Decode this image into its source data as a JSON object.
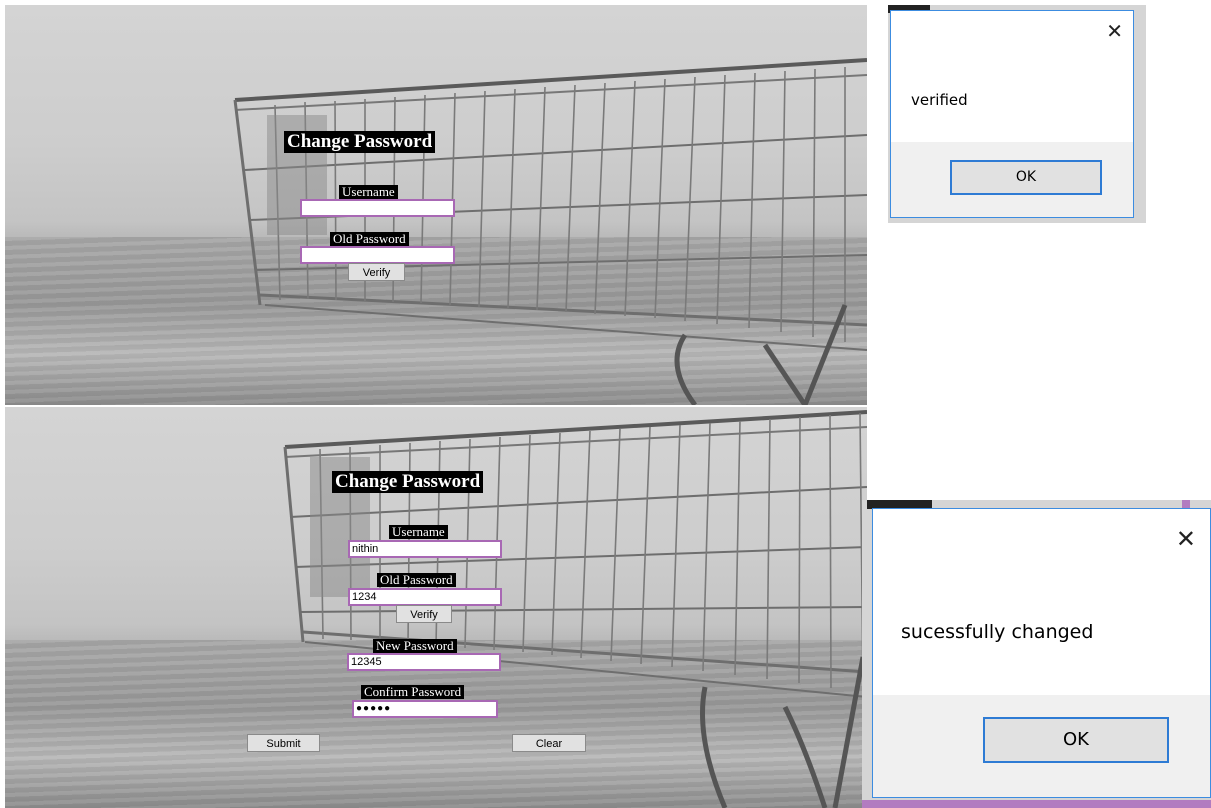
{
  "top_form": {
    "title": "Change Password",
    "username_label": "Username",
    "username_value": "",
    "old_password_label": "Old Password",
    "old_password_value": "",
    "verify_button": "Verify"
  },
  "top_dialog": {
    "message": "verified",
    "ok_button": "OK",
    "close_glyph": "✕"
  },
  "bottom_form": {
    "title": "Change Password",
    "username_label": "Username",
    "username_value": "nithin",
    "old_password_label": "Old Password",
    "old_password_value": "1234",
    "verify_button": "Verify",
    "new_password_label": "New Password",
    "new_password_value": "12345",
    "confirm_password_label": "Confirm Password",
    "confirm_password_value": "●●●●●",
    "submit_button": "Submit",
    "clear_button": "Clear"
  },
  "bottom_dialog": {
    "message": "sucessfully changed",
    "ok_button": "OK",
    "close_glyph": "✕"
  },
  "colors": {
    "field_border": "#a868b4",
    "dialog_border": "#3c8ce0",
    "ok_border": "#2e7bd4",
    "label_bg": "#000000"
  },
  "icons": [
    "close-icon",
    "shopping-cart-background"
  ]
}
